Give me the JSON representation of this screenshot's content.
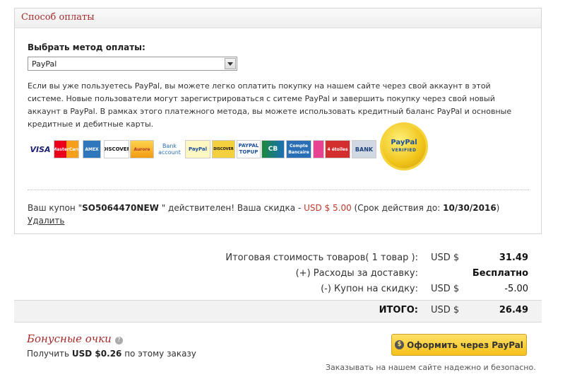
{
  "panel": {
    "title": "Способ оплаты",
    "method_label": "Выбрать метод оплаты:",
    "selected_method": "PayPal",
    "description": "Если вы уже пользуетесь PayPal, вы можете легко оплатить покупку на нашем сайте через свой аккаунт в этой системе. Новые пользователи могут зарегистрироваться с ситеме PayPal и завершить покупку через свой новый аккаунт в PayPal. В рамках этого платежного метода, вы можете использовать кредитный баланс PayPal и основные кредитные и дебитные карты.",
    "logos": [
      "VISA",
      "MasterCard",
      "AMEX",
      "DISCOVER",
      "Aurore",
      "Bank account",
      "PayPal",
      "DISCOVER",
      "PAYPAL TOPUP",
      "CB",
      "Compte Bancaire",
      "4 étoiles",
      "BANK"
    ],
    "seal": {
      "line1": "PayPal",
      "line2": "VERIFIED"
    }
  },
  "coupon": {
    "prefix": "Ваш купон \"",
    "code": "SO5064470NEW",
    "middle": " \" действителен! Ваша скидка - ",
    "discount": "USD $ 5.00",
    "expiry_prefix": " (Срок действия до: ",
    "expiry": "10/30/2016",
    "expiry_suffix": ")",
    "remove": "Удалить"
  },
  "totals": {
    "subtotal_label": "Итоговая стоимость товаров( 1 товар ):",
    "subtotal_currency": "USD $",
    "subtotal_value": "31.49",
    "shipping_label": "(+) Расходы за доставку:",
    "shipping_value": "Бесплатно",
    "coupon_label": "(-) Купон на скидку:",
    "coupon_currency": "USD $",
    "coupon_value": "-5.00",
    "total_label": "ИТОГО:",
    "total_currency": "USD $",
    "total_value": "26.49"
  },
  "bonus": {
    "title": "Бонусные очки",
    "help_icon": "?",
    "text_prefix": "Получить ",
    "amount": "USD $0.26",
    "text_suffix": " по этому заказу"
  },
  "checkout": {
    "icon": "$",
    "button_label": "Оформить через PayPal",
    "safe_text": "Заказывать на нашем сайте надежно и безопасно."
  },
  "colors": {
    "accent": "#a52a2a",
    "discount": "#c0392b",
    "button": "#f5c11a"
  }
}
